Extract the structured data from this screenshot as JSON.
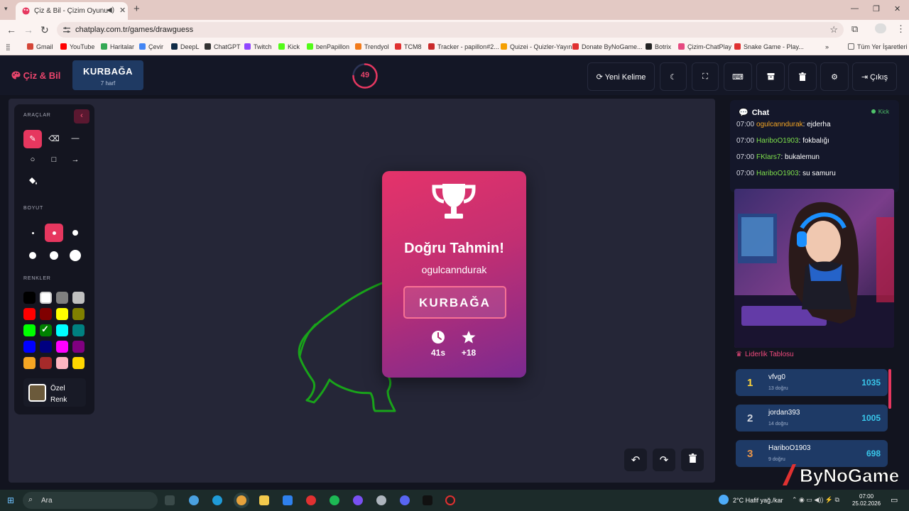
{
  "browser": {
    "tab_title": "Çiz & Bil - Çizim Oyunu",
    "url": "chatplay.com.tr/games/drawguess",
    "bookmarks": [
      {
        "label": "Gmail",
        "color": "#d44638"
      },
      {
        "label": "YouTube",
        "color": "#ff0000"
      },
      {
        "label": "Haritalar",
        "color": "#34a853"
      },
      {
        "label": "Çevir",
        "color": "#4285f4"
      },
      {
        "label": "DeepL",
        "color": "#0f2b46"
      },
      {
        "label": "ChatGPT",
        "color": "#333333"
      },
      {
        "label": "Twitch",
        "color": "#9146ff"
      },
      {
        "label": "Kick",
        "color": "#53fc18"
      },
      {
        "label": "benPapillon",
        "color": "#53fc18"
      },
      {
        "label": "Trendyol",
        "color": "#f27a1a"
      },
      {
        "label": "TCM8",
        "color": "#e03131"
      },
      {
        "label": "Tracker - papillon#2...",
        "color": "#c92a2a"
      },
      {
        "label": "Quizei - Quizler-Yayın",
        "color": "#f59f00"
      },
      {
        "label": "Donate ByNoGame...",
        "color": "#e03131"
      },
      {
        "label": "Botrix",
        "color": "#222222"
      },
      {
        "label": "Çizim-ChatPlay",
        "color": "#e64980"
      },
      {
        "label": "Snake Game - Play...",
        "color": "#e03131"
      }
    ],
    "all_bookmarks": "Tüm Yer İşaretleri"
  },
  "header": {
    "logo": "Çiz & Bil",
    "word": "KURBAĞA",
    "word_hint": "7 harf",
    "timer": "49",
    "timer_fraction": 0.75,
    "new_word": "Yeni Kelime",
    "exit": "Çıkış"
  },
  "tools": {
    "section_tools": "ARAÇLAR",
    "section_size": "BOYUT",
    "section_colors": "RENKLER",
    "custom_color_label": "Özel Renk",
    "custom_color": "#6b5a3b",
    "palette": [
      "#000000",
      "#ffffff",
      "#808080",
      "#c0c0c0",
      "#ff0000",
      "#800000",
      "#ffff00",
      "#808000",
      "#00ff00",
      "#008000",
      "#00ffff",
      "#008080",
      "#0000ff",
      "#000080",
      "#ff00ff",
      "#800080",
      "#f5a623",
      "#a52a2a",
      "#ffb6c1",
      "#ffd700"
    ],
    "selected_color": "#008000"
  },
  "modal": {
    "title": "Doğru Tahmin!",
    "user": "ogulcanndurak",
    "word": "KURBAĞA",
    "time": "41s",
    "points": "+18"
  },
  "chat": {
    "title": "Chat",
    "source": "Kick",
    "messages": [
      {
        "time": "07:00",
        "user": "ogulcanndurak",
        "text": ": ejderha",
        "color": "#f5a623"
      },
      {
        "time": "07:00",
        "user": "HariboO1903",
        "text": ": fokbalığı",
        "color": "#7ee04b"
      },
      {
        "time": "07:00",
        "user": "FKlars7",
        "text": ": bukalemun",
        "color": "#7ee04b"
      },
      {
        "time": "07:00",
        "user": "HariboO1903",
        "text": ": su samuru",
        "color": "#7ee04b"
      }
    ]
  },
  "leaderboard": {
    "title": "Liderlik Tablosu",
    "rows": [
      {
        "rank": "1",
        "name": "vfvg0",
        "sub": "13 doğru",
        "score": "1035",
        "rank_color": "#ffd43b"
      },
      {
        "rank": "2",
        "name": "jordan393",
        "sub": "14 doğru",
        "score": "1005",
        "rank_color": "#d0d4dc"
      },
      {
        "rank": "3",
        "name": "HariboO1903",
        "sub": "9 doğru",
        "score": "698",
        "rank_color": "#e8954a"
      }
    ]
  },
  "watermark": "ByNoGame",
  "taskbar": {
    "search": "Ara",
    "weather": "2°C  Hafif yağ./kar",
    "time": "07:00",
    "date": "25.02.2026"
  },
  "colors": {
    "accent": "#e6375f",
    "panel": "#141726",
    "canvas": "#252637"
  }
}
